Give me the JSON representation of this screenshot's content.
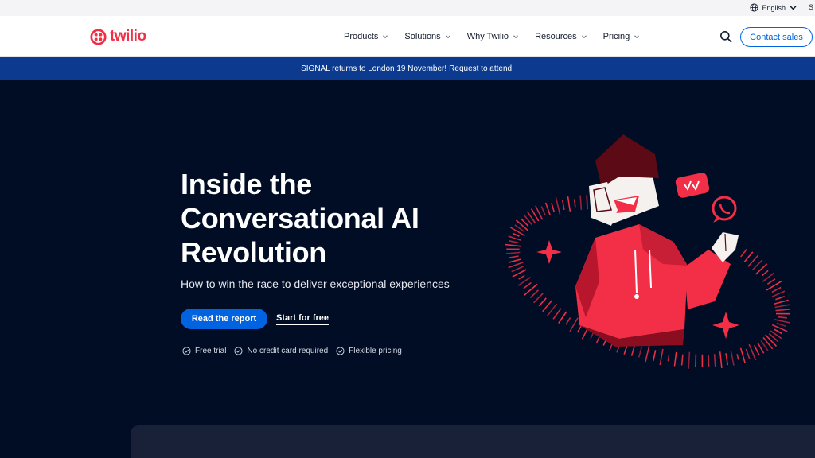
{
  "utility": {
    "language": "English",
    "edge_letter": "S"
  },
  "header": {
    "logo_text": "twilio",
    "nav": [
      {
        "label": "Products"
      },
      {
        "label": "Solutions"
      },
      {
        "label": "Why Twilio"
      },
      {
        "label": "Resources"
      },
      {
        "label": "Pricing"
      }
    ],
    "contact_label": "Contact sales"
  },
  "banner": {
    "text": "SIGNAL returns to London 19 November!",
    "link": "Request to attend",
    "suffix": "."
  },
  "hero": {
    "title": "Inside the Conversational AI Revolution",
    "subtitle": "How to win the race to deliver exceptional experiences",
    "primary_cta": "Read the report",
    "secondary_cta": "Start for free",
    "perks": [
      "Free trial",
      "No credit card required",
      "Flexible pricing"
    ]
  },
  "colors": {
    "brand_red": "#f22f46",
    "accent_blue": "#0263e0",
    "banner_blue": "#0b3a8f",
    "hero_bg": "#000d25"
  },
  "icons": [
    "globe-icon",
    "chevron-down-icon",
    "twilio-logo-icon",
    "search-icon",
    "check-circle-icon",
    "sparkle-icon",
    "chat-bubble-icon",
    "whatsapp-icon"
  ]
}
